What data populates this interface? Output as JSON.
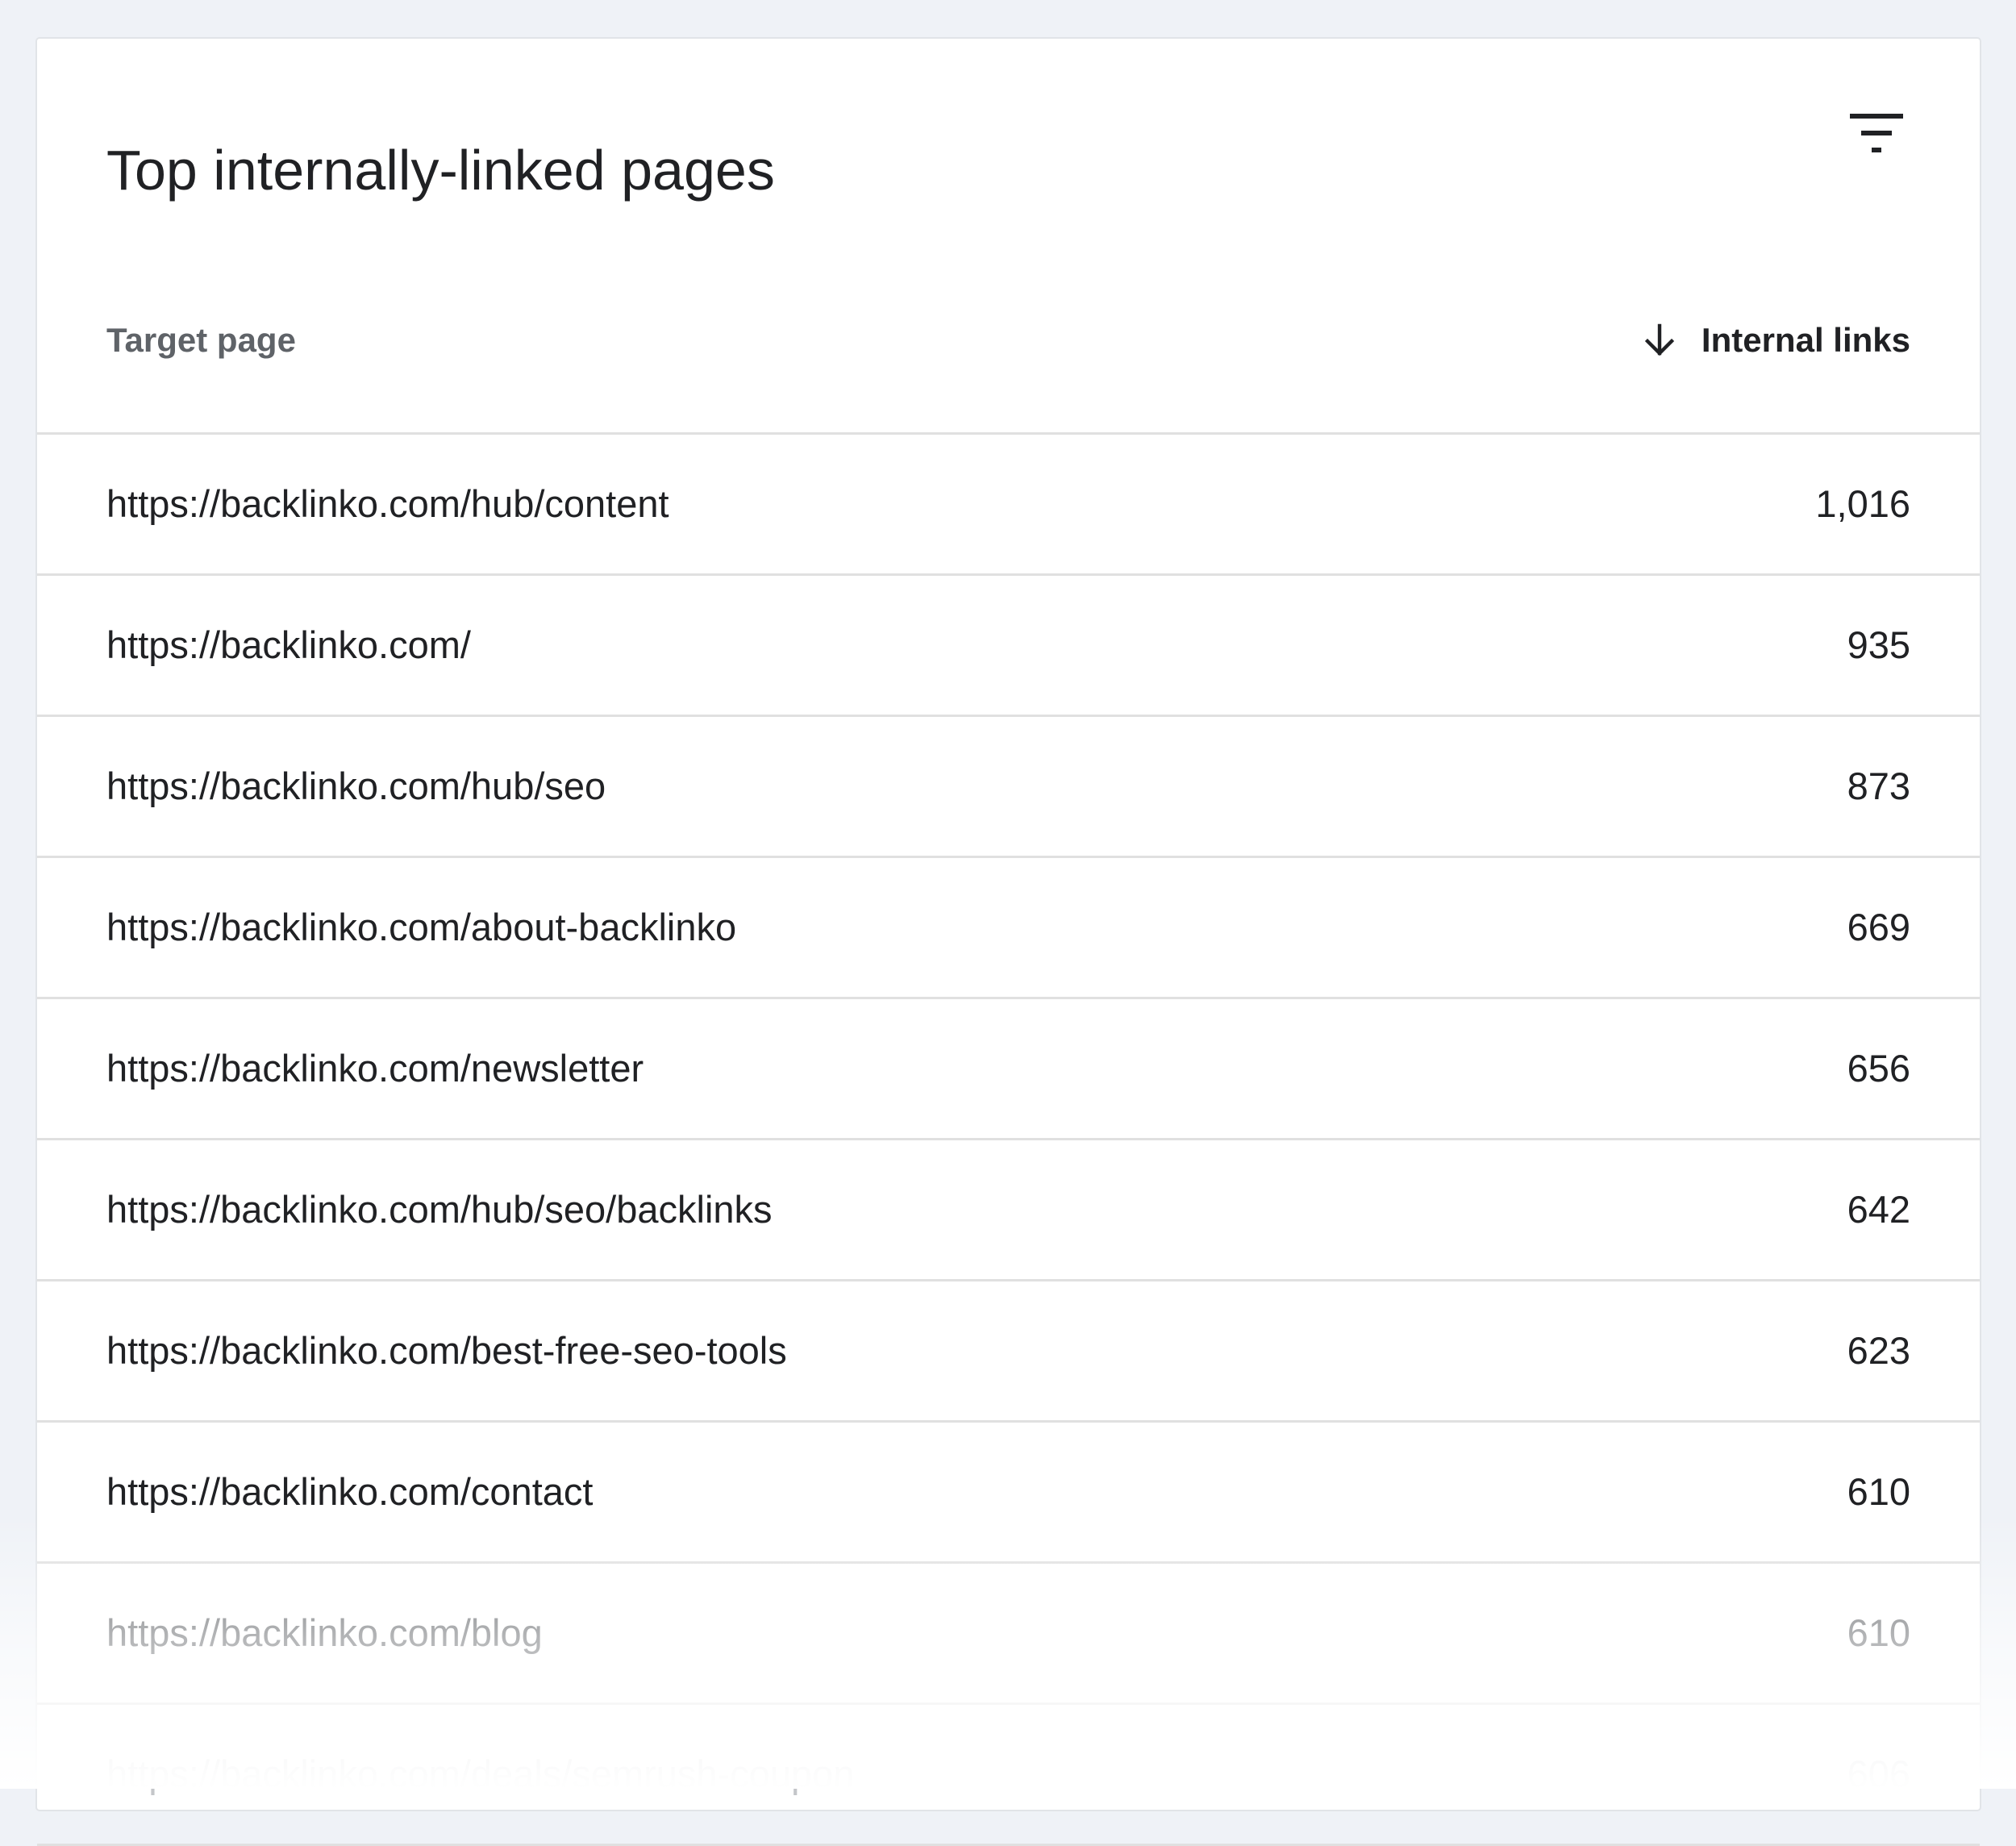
{
  "card": {
    "title": "Top internally-linked pages",
    "filter_icon": "filter-list-icon"
  },
  "table": {
    "columns": {
      "target": "Target page",
      "links": "Internal links",
      "sort_icon": "arrow-downward-icon",
      "sort_direction": "descending"
    },
    "rows": [
      {
        "url": "https://backlinko.com/hub/content",
        "links": "1,016"
      },
      {
        "url": "https://backlinko.com/",
        "links": "935"
      },
      {
        "url": "https://backlinko.com/hub/seo",
        "links": "873"
      },
      {
        "url": "https://backlinko.com/about-backlinko",
        "links": "669"
      },
      {
        "url": "https://backlinko.com/newsletter",
        "links": "656"
      },
      {
        "url": "https://backlinko.com/hub/seo/backlinks",
        "links": "642"
      },
      {
        "url": "https://backlinko.com/best-free-seo-tools",
        "links": "623"
      },
      {
        "url": "https://backlinko.com/contact",
        "links": "610"
      },
      {
        "url": "https://backlinko.com/blog",
        "links": "610"
      },
      {
        "url": "https://backlinko.com/deals/semrush-coupon",
        "links": "606"
      }
    ]
  },
  "colors": {
    "background": "#eff2f7",
    "card": "#ffffff",
    "text": "#202124",
    "muted": "#5f6368",
    "divider": "#e0e0e0"
  }
}
